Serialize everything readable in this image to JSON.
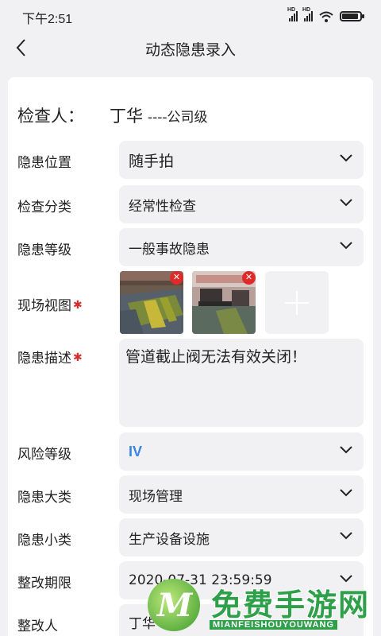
{
  "status_bar": {
    "time": "下午2:51",
    "network_tag": "HD",
    "battery_level": 0.9
  },
  "nav": {
    "title": "动态隐患录入",
    "back_icon": "chevron-left-icon"
  },
  "inspector": {
    "label": "检查人：",
    "name": "丁华",
    "level": "----公司级"
  },
  "fields": {
    "location": {
      "label": "隐患位置",
      "value": "随手拍"
    },
    "category": {
      "label": "检查分类",
      "value": "经常性检查"
    },
    "grade": {
      "label": "隐患等级",
      "value": "一般事故隐患"
    },
    "photos": {
      "label": "现场视图",
      "required_mark": "✱",
      "count": 2,
      "add_icon": "plus-icon",
      "delete_icon": "close-icon"
    },
    "description": {
      "label": "隐患描述",
      "required_mark": "✱",
      "value": "管道截止阀无法有效关闭！"
    },
    "risk_level": {
      "label": "风险等级",
      "value": "IV",
      "color": "#3b84e0"
    },
    "major_type": {
      "label": "隐患大类",
      "value": "现场管理"
    },
    "minor_type": {
      "label": "隐患小类",
      "value": "生产设备设施"
    },
    "deadline": {
      "label": "整改期限",
      "value": "2020-07-31 23:59:59"
    },
    "rectifier": {
      "label": "整改人",
      "value": "丁华"
    }
  },
  "watermark": {
    "logo_letter": "M",
    "title": "免费手游网",
    "subtitle": "MIANFEISHOUYOUWANG"
  },
  "colors": {
    "background": "#f1f1f3",
    "card": "#ffffff",
    "field": "#f1f1f3",
    "required": "#d42b2b",
    "delete_badge": "#e02a2a",
    "watermark_green": "#2ea04a"
  }
}
